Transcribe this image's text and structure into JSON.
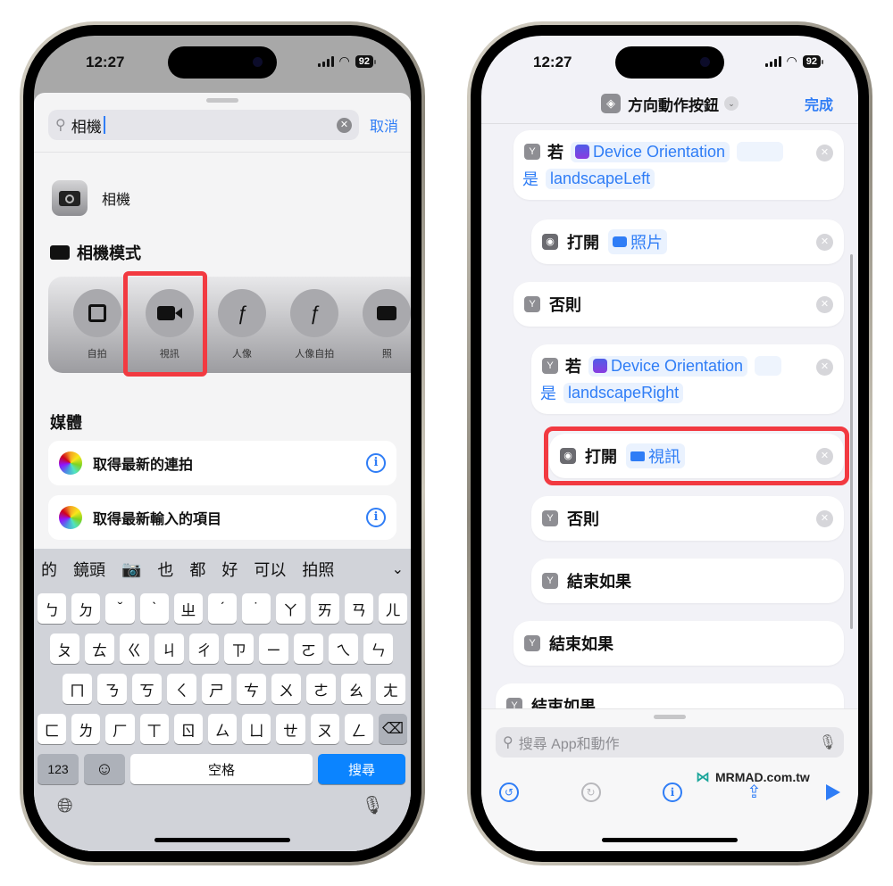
{
  "status_bar": {
    "time": "12:27",
    "battery": "92"
  },
  "left_phone": {
    "search": {
      "value": "相機",
      "cancel_label": "取消"
    },
    "app_result": {
      "label": "相機",
      "icon": "camera-app-icon"
    },
    "camera_modes": {
      "heading": "相機模式",
      "modes": [
        {
          "label": "自拍",
          "icon": "selfie-portrait-icon"
        },
        {
          "label": "視訊",
          "icon": "video-camera-icon",
          "highlighted": true
        },
        {
          "label": "人像",
          "icon": "aperture-f-icon"
        },
        {
          "label": "人像自拍",
          "icon": "aperture-f-icon"
        },
        {
          "label": "照",
          "icon": "camera-icon"
        }
      ]
    },
    "media": {
      "heading": "媒體",
      "items": [
        {
          "label": "取得最新的連拍",
          "icon": "photos-icon"
        },
        {
          "label": "取得最新輸入的項目",
          "icon": "photos-icon"
        }
      ]
    },
    "keyboard": {
      "candidates": [
        "的",
        "鏡頭",
        "📷",
        "也",
        "都",
        "好",
        "可以",
        "拍照"
      ],
      "rows": [
        [
          "ㄅ",
          "ㄉ",
          "ˇ",
          "ˋ",
          "ㄓ",
          "ˊ",
          "˙",
          "ㄚ",
          "ㄞ",
          "ㄢ",
          "ㄦ"
        ],
        [
          "ㄆ",
          "ㄊ",
          "ㄍ",
          "ㄐ",
          "ㄔ",
          "ㄗ",
          "ㄧ",
          "ㄛ",
          "ㄟ",
          "ㄣ"
        ],
        [
          "ㄇ",
          "ㄋ",
          "ㄎ",
          "ㄑ",
          "ㄕ",
          "ㄘ",
          "ㄨ",
          "ㄜ",
          "ㄠ",
          "ㄤ"
        ],
        [
          "ㄈ",
          "ㄌ",
          "ㄏ",
          "ㄒ",
          "ㄖ",
          "ㄙ",
          "ㄩ",
          "ㄝ",
          "ㄡ",
          "ㄥ"
        ]
      ],
      "numbers_key": "123",
      "emoji_key": "☺",
      "space_key": "空格",
      "search_key": "搜尋",
      "delete_key": "⌫"
    }
  },
  "right_phone": {
    "nav": {
      "title": "方向動作按鈕",
      "done_label": "完成"
    },
    "actions": [
      {
        "type": "if",
        "keyword": "若",
        "variable": "Device Orientation",
        "is_label": "是",
        "value": "landscapeLeft"
      },
      {
        "type": "open",
        "keyword": "打開",
        "target": "照片"
      },
      {
        "type": "otherwise",
        "keyword": "否則"
      },
      {
        "type": "if",
        "keyword": "若",
        "variable": "Device Orientation",
        "is_label": "是",
        "value": "landscapeRight"
      },
      {
        "type": "open",
        "keyword": "打開",
        "target": "視訊",
        "highlighted": true
      },
      {
        "type": "otherwise",
        "keyword": "否則"
      },
      {
        "type": "end_if",
        "keyword": "結束如果"
      },
      {
        "type": "end_if",
        "keyword": "結束如果"
      },
      {
        "type": "end_if",
        "keyword": "結束如果"
      }
    ],
    "bottom_search": {
      "placeholder": "搜尋 App和動作"
    },
    "watermark": "MRMAD.com.tw",
    "toolbar": [
      "undo",
      "redo",
      "info",
      "share",
      "play"
    ]
  },
  "colors": {
    "accent": "#2f7df6",
    "highlight": "#f23a41",
    "keyboard_blue": "#0b84ff"
  }
}
